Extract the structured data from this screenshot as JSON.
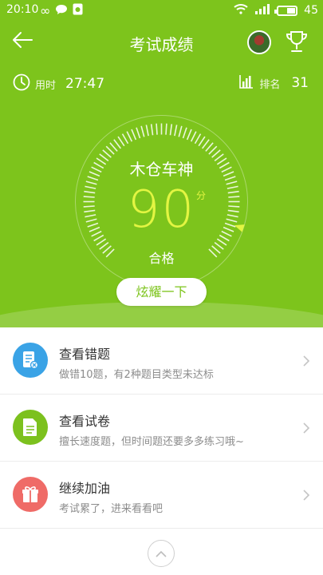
{
  "status_bar": {
    "time": "20:10",
    "battery": "45"
  },
  "header": {
    "title": "考试成绩"
  },
  "stats": {
    "time_label": "用时",
    "time_value": "27:47",
    "rank_label": "排名",
    "rank_value": "31"
  },
  "result": {
    "user_name": "木仓车神",
    "score": "90",
    "score_unit": "分",
    "status": "合格",
    "score_fraction": 0.9
  },
  "share_button": {
    "label": "炫耀一下"
  },
  "actions": [
    {
      "title": "查看错题",
      "desc": "做错10题，有2种题目类型未达标",
      "icon": "wrong-questions-icon",
      "color": "#3aa3e6"
    },
    {
      "title": "查看试卷",
      "desc": "擅长速度题，但时间题还要多多练习哦~",
      "icon": "exam-paper-icon",
      "color": "#7cc11e"
    },
    {
      "title": "继续加油",
      "desc": "考试累了，进来看看吧",
      "icon": "gift-icon",
      "color": "#ef6b67"
    }
  ],
  "colors": {
    "primary": "#7dc41c",
    "score": "#e3f542"
  }
}
